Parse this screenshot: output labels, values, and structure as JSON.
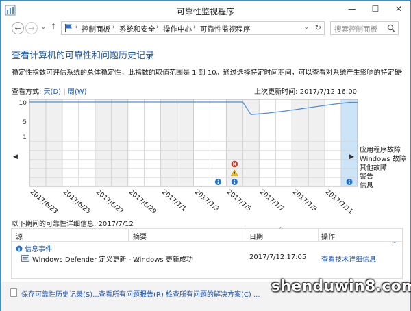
{
  "window": {
    "title": "可靠性监视程序",
    "min_glyph": "—",
    "max_glyph": "☐",
    "close_glyph": "✕"
  },
  "nav": {
    "back_glyph": "←",
    "forward_glyph": "→",
    "up_glyph": "↑",
    "breadcrumb": [
      "控制面板",
      "系统和安全",
      "操作中心",
      "可靠性监视程序"
    ],
    "search_placeholder": "搜索控制面板"
  },
  "heading": "查看计算机的可靠性和问题历史记录",
  "description": "稳定性指数可评估系统的总体稳定性，此指数的取值范围是 1 到 10。通过选择特定时间期间，可以查看对系统产生影响的特定硬件和软件问题。",
  "view_by": {
    "label": "查看方式:",
    "day": "天(D)",
    "separator": "|",
    "week": "周(W)"
  },
  "last_updated": "上次更新时间: 2017/7/12 16:00",
  "chart_data": {
    "type": "line",
    "ytick_labels": [
      "10",
      "5",
      "1"
    ],
    "ylim": [
      1,
      10
    ],
    "columns": 20,
    "date_labels": [
      "2017/6/23",
      "2017/6/25",
      "2017/6/27",
      "2017/6/29",
      "2017/7/1",
      "2017/7/3",
      "2017/7/5",
      "2017/7/7",
      "2017/7/9",
      "2017/7/11"
    ],
    "stability_index": [
      10,
      10,
      10,
      10,
      10,
      10,
      10,
      10,
      10,
      10,
      10,
      10,
      10,
      6.7,
      7.1,
      7.6,
      8.2,
      8.8,
      9.4,
      9.9
    ],
    "event_rows": [
      "应用程序故障",
      "Windows 故障",
      "其他故障",
      "警告",
      "信息"
    ],
    "events": [
      {
        "column": 11,
        "row": "信息",
        "kind": "info"
      },
      {
        "column": 12,
        "row": "其他故障",
        "kind": "error"
      },
      {
        "column": 12,
        "row": "警告",
        "kind": "warning"
      },
      {
        "column": 12,
        "row": "信息",
        "kind": "info"
      },
      {
        "column": 19,
        "row": "信息",
        "kind": "info"
      }
    ],
    "selected_column": 19,
    "grid": true,
    "colors": {
      "line": "#4a90d9",
      "selected": "#cce4f7",
      "shaded": "#f0f0f0",
      "grid": "#cfcfcf"
    }
  },
  "details": {
    "title": "以下期间的可靠性详细信息: 2017/7/12",
    "columns": [
      "源",
      "摘要",
      "日期",
      "操作"
    ],
    "group_label": "信息事件",
    "rows": [
      {
        "source": "Windows Defender 定义更新 - ...",
        "summary": "Windows 更新成功",
        "date": "2017/7/12 17:05",
        "action": "查看技术详细信息"
      }
    ]
  },
  "footer": {
    "save_history": "保存可靠性历史记录(S)...",
    "view_reports": "查看所有问题报告(R)",
    "check_solutions": "检查所有问题的解决方案(C) ..."
  },
  "watermark": "shenduwin8.com",
  "colors": {
    "accent": "#1e5aa8",
    "link": "#1a56b8",
    "border": "#3c8dd1"
  }
}
